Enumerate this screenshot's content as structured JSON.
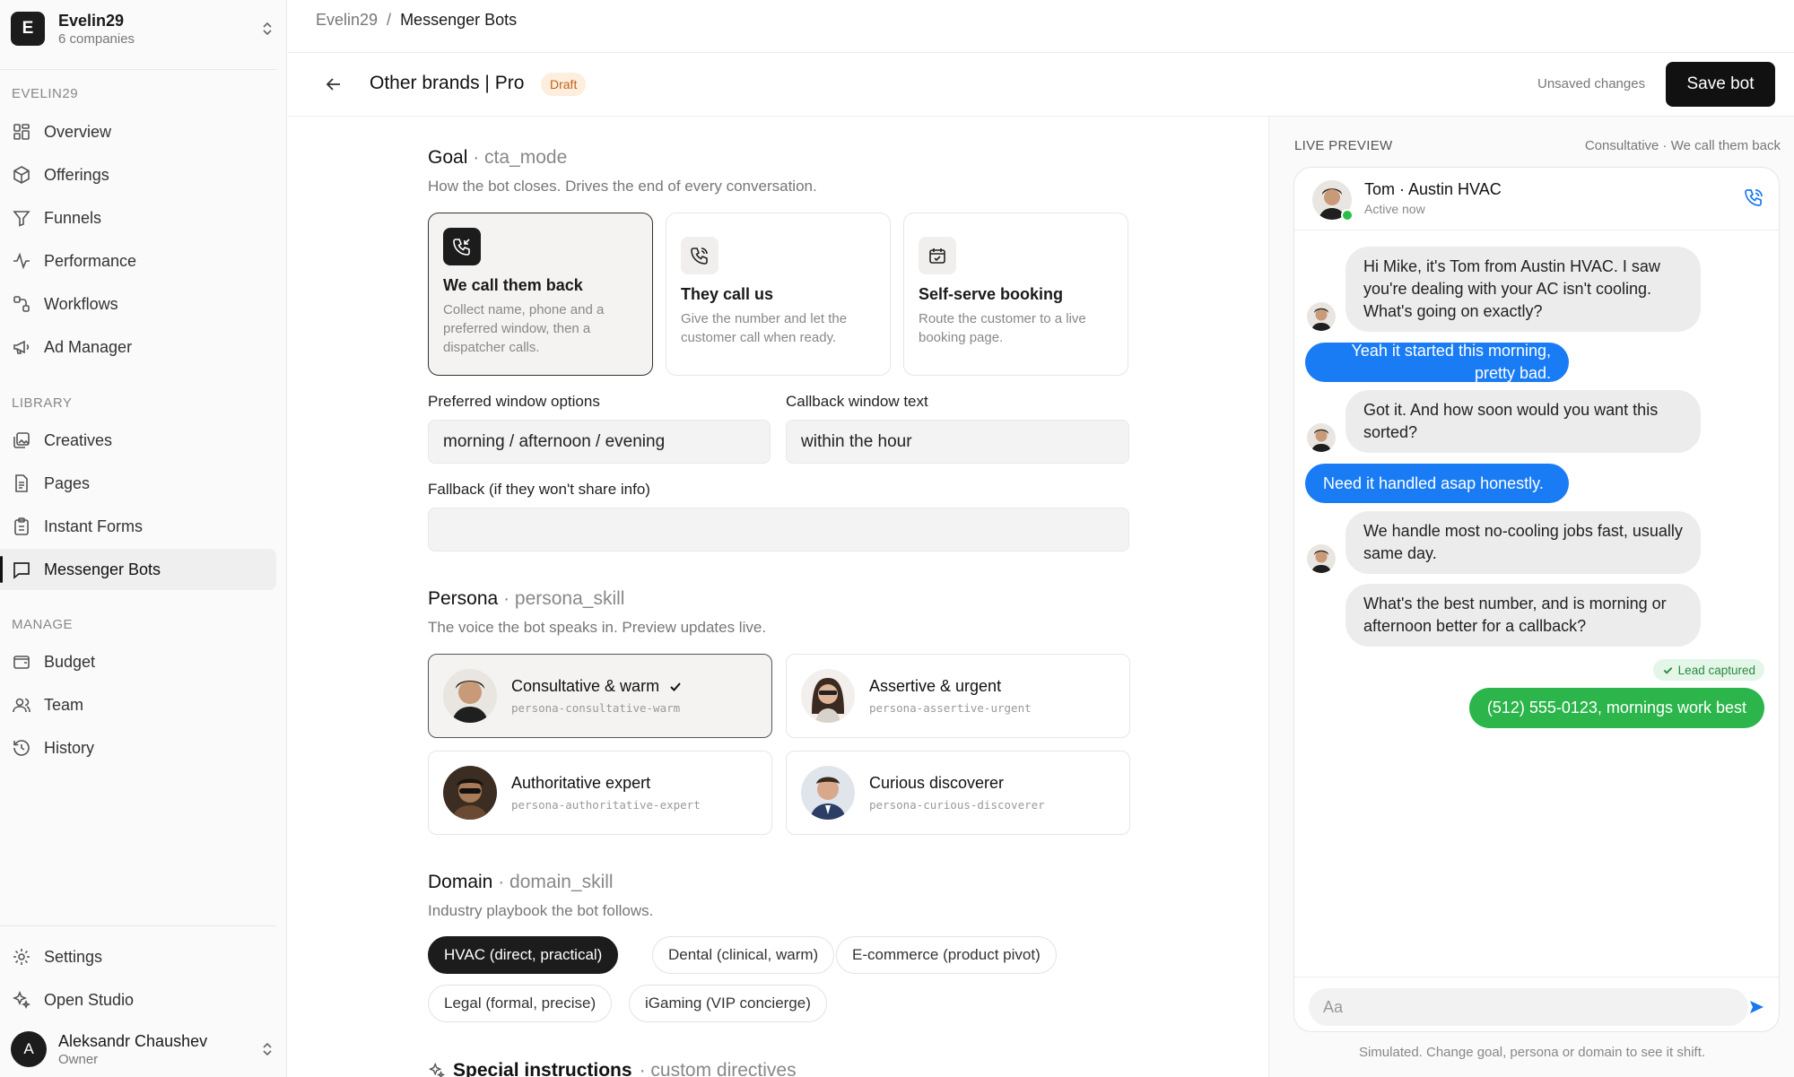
{
  "workspace": {
    "initial": "E",
    "name": "Evelin29",
    "subtitle": "6 companies"
  },
  "nav": {
    "section1": "EVELIN29",
    "items1": [
      {
        "label": "Overview",
        "icon": "overview-icon"
      },
      {
        "label": "Offerings",
        "icon": "box-icon"
      },
      {
        "label": "Funnels",
        "icon": "funnel-icon"
      },
      {
        "label": "Performance",
        "icon": "activity-icon"
      },
      {
        "label": "Workflows",
        "icon": "workflow-icon"
      },
      {
        "label": "Ad Manager",
        "icon": "megaphone-icon"
      }
    ],
    "section2": "LIBRARY",
    "items2": [
      {
        "label": "Creatives",
        "icon": "image-stack-icon"
      },
      {
        "label": "Pages",
        "icon": "page-icon"
      },
      {
        "label": "Instant Forms",
        "icon": "clipboard-icon"
      },
      {
        "label": "Messenger Bots",
        "icon": "chat-icon",
        "active": true
      }
    ],
    "section3": "MANAGE",
    "items3": [
      {
        "label": "Budget",
        "icon": "wallet-icon"
      },
      {
        "label": "Team",
        "icon": "team-icon"
      },
      {
        "label": "History",
        "icon": "history-icon"
      }
    ],
    "bottom": [
      {
        "label": "Settings",
        "icon": "gear-icon"
      },
      {
        "label": "Open Studio",
        "icon": "sparkle-icon"
      }
    ]
  },
  "user": {
    "initial": "A",
    "name": "Aleksandr Chaushev",
    "role": "Owner"
  },
  "breadcrumb": {
    "parent": "Evelin29",
    "sep": "/",
    "current": "Messenger Bots"
  },
  "header": {
    "title": "Other brands | Pro",
    "badge": "Draft",
    "unsaved": "Unsaved changes",
    "save": "Save bot"
  },
  "goal": {
    "title": "Goal",
    "code": "· cta_mode",
    "desc": "How the bot closes. Drives the end of every conversation.",
    "options": [
      {
        "title": "We call them back",
        "desc": "Collect name, phone and a preferred window, then a dispatcher calls.",
        "selected": true
      },
      {
        "title": "They call us",
        "desc": "Give the number and let the customer call when ready."
      },
      {
        "title": "Self-serve booking",
        "desc": "Route the customer to a live booking page."
      }
    ],
    "window_label": "Preferred window options",
    "window_value": "morning / afternoon / evening",
    "callback_label": "Callback window text",
    "callback_value": "within the hour",
    "fallback_label": "Fallback (if they won't share info)",
    "fallback_value": ""
  },
  "persona": {
    "title": "Persona",
    "code": "· persona_skill",
    "desc": "The voice the bot speaks in. Preview updates live.",
    "options": [
      {
        "name": "Consultative & warm",
        "code": "persona-consultative-warm",
        "selected": true
      },
      {
        "name": "Assertive & urgent",
        "code": "persona-assertive-urgent"
      },
      {
        "name": "Authoritative expert",
        "code": "persona-authoritative-expert"
      },
      {
        "name": "Curious discoverer",
        "code": "persona-curious-discoverer"
      }
    ]
  },
  "domain": {
    "title": "Domain",
    "code": "· domain_skill",
    "desc": "Industry playbook the bot follows.",
    "chips": [
      "HVAC (direct, practical)",
      "Dental (clinical, warm)",
      "E-commerce (product pivot)",
      "Legal (formal, precise)",
      "iGaming (VIP concierge)"
    ],
    "selected": "HVAC (direct, practical)"
  },
  "special": {
    "title": "Special instructions",
    "code": "· custom directives"
  },
  "preview": {
    "label": "LIVE PREVIEW",
    "subtitle": "Consultative · We call them back",
    "contact": "Tom · Austin HVAC",
    "status": "Active now",
    "messages": [
      {
        "from": "bot",
        "text": "Hi Mike, it's Tom from Austin HVAC. I saw you're dealing with your AC isn't cooling. What's going on exactly?"
      },
      {
        "from": "user",
        "text": "Yeah it started this morning, pretty bad."
      },
      {
        "from": "bot",
        "text": "Got it. And how soon would you want this sorted?"
      },
      {
        "from": "user",
        "text": "Need it handled asap honestly."
      },
      {
        "from": "bot",
        "text": "We handle most no-cooling jobs fast, usually same day."
      },
      {
        "from": "bot",
        "text": "What's the best number, and is morning or afternoon better for a callback?"
      },
      {
        "from": "user",
        "text": "(512) 555-0123, mornings work best"
      }
    ],
    "captured": "Lead captured",
    "input_placeholder": "Aa",
    "footer": "Simulated. Change goal, persona or domain to see it shift."
  },
  "colors": {
    "accent": "#1a7cf5",
    "lead": "#2bb54b",
    "draft_bg": "#fdeedd",
    "draft_fg": "#c0621a",
    "dark": "#1c1c1c"
  }
}
